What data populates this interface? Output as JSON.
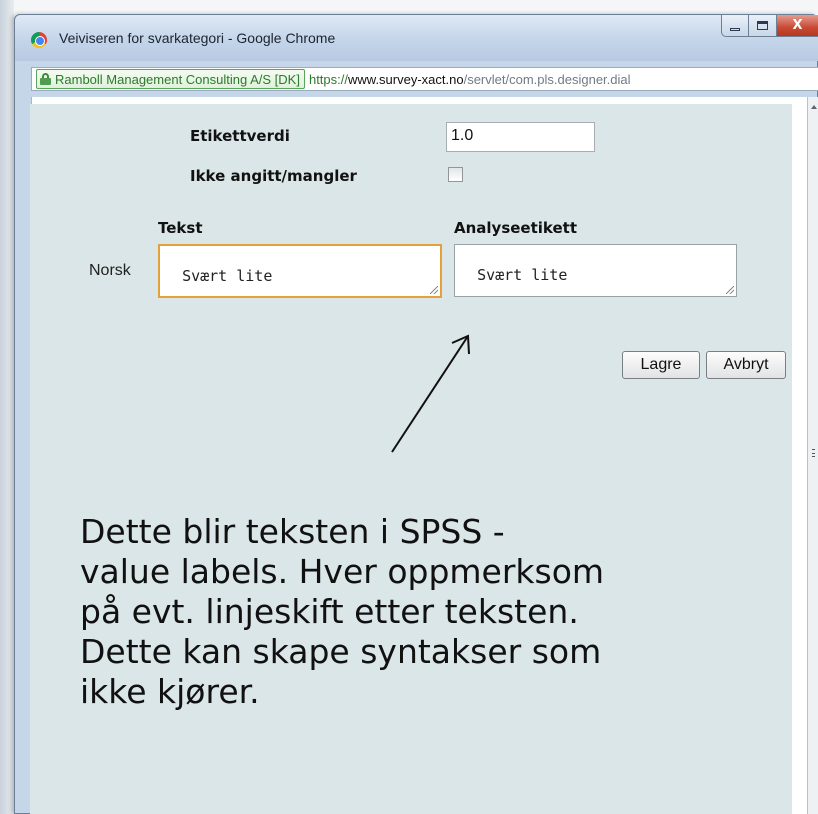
{
  "window": {
    "title": "Veiviseren for svarkategori - Google Chrome",
    "minimize_glyph": "minimize-icon",
    "maximize_glyph": "maximize-icon",
    "close_label": "X"
  },
  "address_bar": {
    "ev_certificate": "Ramboll Management Consulting A/S [DK]",
    "url_scheme": "https://",
    "url_host": "www.survey-xact.no",
    "url_path": "/servlet/com.pls.designer.dial"
  },
  "form": {
    "label_value_label": "Etikettverdi",
    "label_value": "1.0",
    "missing_label": "Ikke angitt/mangler",
    "missing_checked": false,
    "col_text": "Tekst",
    "col_analysis": "Analyseetikett",
    "row_language": "Norsk",
    "text_value": "Svært lite",
    "analysis_value": "Svært lite"
  },
  "buttons": {
    "save": "Lagre",
    "cancel": "Avbryt"
  },
  "annotation": {
    "lines": [
      "Dette blir teksten i SPSS -",
      "value labels. Hver oppmerksom",
      "på evt. linjeskift etter teksten.",
      "Dette kan skape syntakser som",
      "ikke kjører."
    ]
  },
  "colors": {
    "content_bg": "#dbe6e8",
    "focus_border": "#e3a13a",
    "ev_green": "#2c7a2c"
  }
}
